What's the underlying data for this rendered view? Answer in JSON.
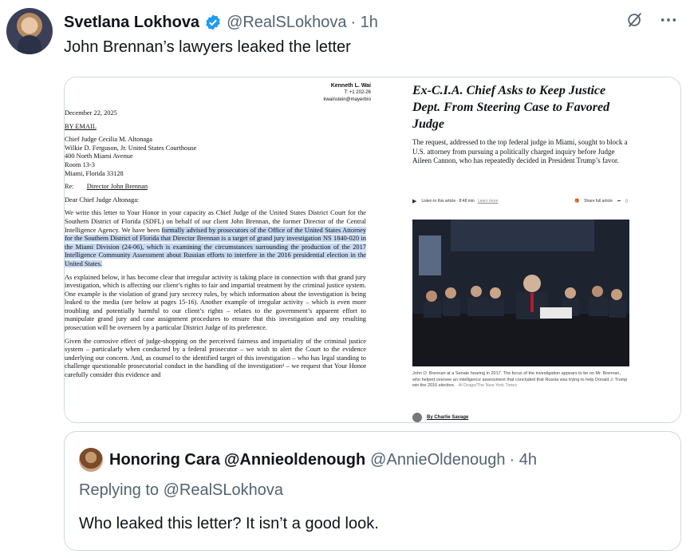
{
  "tweet": {
    "author_name": "Svetlana Lokhova",
    "handle": "@RealSLokhova",
    "time": "· 1h",
    "text": "John Brennan’s lawyers leaked the letter",
    "icons": [
      "grok-icon",
      "more-icon"
    ]
  },
  "letter": {
    "firm_name": "Kenneth L. Wai",
    "firm_phone": "T: +1 202-26",
    "firm_email": "kwainstein@mayerbro",
    "date": "December 22, 2025",
    "by": "BY EMAIL",
    "address": [
      "Chief Judge Cecilia M. Altonaga",
      "Wilkie D. Ferguson, Jr. United States Courthouse",
      "400 North Miami Avenue",
      "Room 13-3",
      "Miami, Florida 33128"
    ],
    "re_label": "Re:",
    "re_value": "Director John Brennan",
    "salutation": "Dear Chief Judge Altonaga:",
    "p1_a": "We write this letter to Your Honor in your capacity as Chief Judge of the United States District Court for the Southern District of Florida (SDFL) on behalf of our client John Brennan, the former Director of the Central Intelligence Agency.  We have been ",
    "p1_hl": "formally advised by prosecutors of the Office of the United States Attorney for the Southern District of Florida that Director Brennan is a target of grand jury investigation NS 1840-020 in the Miami Division (24-06), which is examining the circumstances surrounding the production of the 2017 Intelligence Community Assessment about Russian efforts to interfere in the 2016 presidential election in the United States.",
    "p2": "As explained below, it has become clear that irregular activity is taking place in connection with that grand jury investigation, which is affecting our client’s rights to fair and impartial treatment by the criminal justice system.  One example is the violation of grand jury secrecy rules, by which information about the investigation is being leaked to the media (see below at pages 15-16).  Another example of irregular activity – which is even more troubling and potentially harmful to our client’s rights – relates to the government’s apparent effort to manipulate grand jury and case assignment procedures to ensure that this investigation and any resulting prosecution will be overseen by a particular District Judge of its preference.",
    "p3": "Given the corrosive effect of judge-shopping on the perceived fairness and impartiality of the criminal justice system – particularly when conducted by a federal prosecutor – we wish to alert the Court to the evidence underlying our concern.  And, as counsel to the identified target of this investigation – who has legal standing to challenge questionable prosecutorial conduct in the handling of the investigation¹ – we request that Your Honor carefully consider this evidence and"
  },
  "article": {
    "headline": "Ex-C.I.A. Chief Asks to Keep Justice Dept. From Steering Case to Favored Judge",
    "dek": "The request, addressed to the top federal judge in Miami, sought to block a U.S. attorney from pursuing a politically charged inquiry before Judge Aileen Cannon, who has repeatedly decided in President Trump’s favor.",
    "listen": "Listen to this article · 8:48 min",
    "learn_more": "Learn more",
    "share": "Share full article",
    "caption": "John O. Brennan at a Senate hearing in 2017. The focus of the investigation appears to be on Mr. Brennan, who helped oversee an intelligence assessment that concluded that Russia was trying to help Donald J. Trump win the 2016 election.",
    "credit": "Al Drago/The New York Times",
    "byline": "By Charlie Savage"
  },
  "quote": {
    "author_name": "Honoring Cara",
    "author_handle_in_name": "@Annieoldenough",
    "handle": "@AnnieOldenough",
    "time": "· 4h",
    "replying_label": "Replying to",
    "replying_to": "@RealSLokhova",
    "text": "Who leaked this letter? It isn’t a good look."
  },
  "colors": {
    "verified": "#1d9bf0",
    "muted": "#536471",
    "highlight": "#c7d9f3",
    "border": "#cfd9de"
  }
}
